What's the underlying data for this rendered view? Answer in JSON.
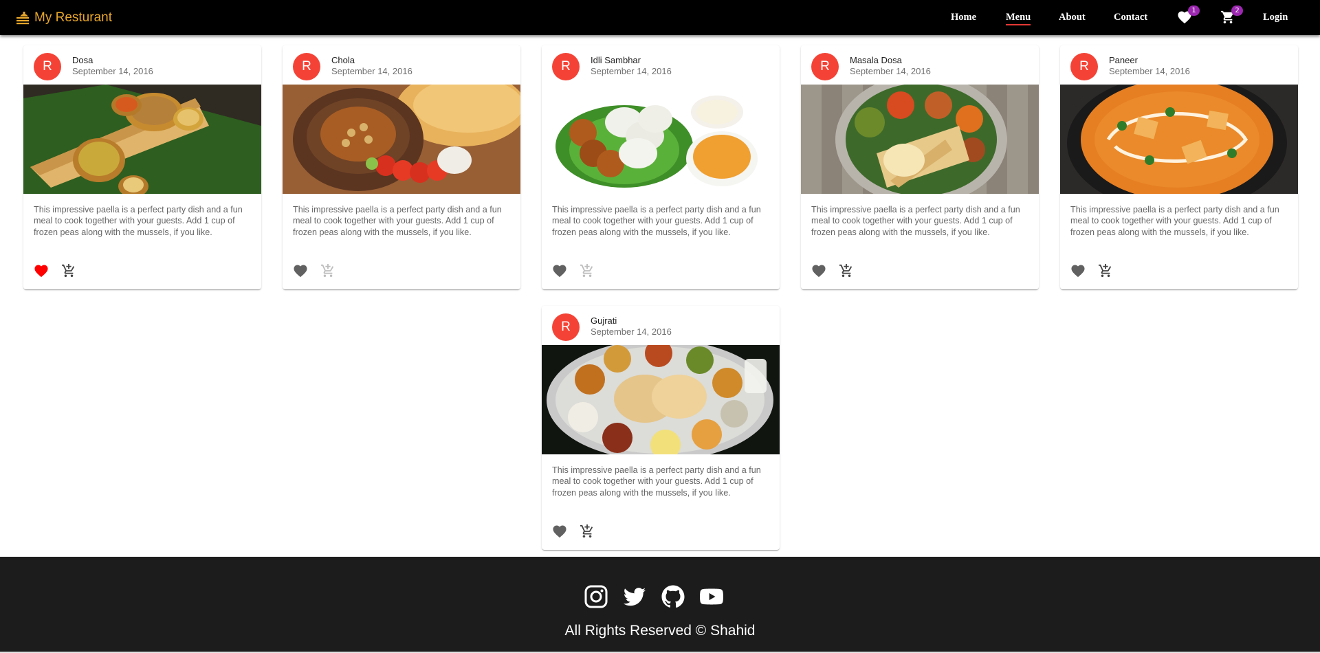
{
  "brand": {
    "name": "My Resturant",
    "icon": "food-cart-icon",
    "color": "#e9a72b"
  },
  "nav": {
    "home": "Home",
    "menu": "Menu",
    "about": "About",
    "contact": "Contact",
    "login": "Login",
    "favorites_icon": "heart-icon",
    "favorites_count": "1",
    "cart_icon": "cart-icon",
    "cart_count": "2",
    "active": "Menu"
  },
  "cards": [
    {
      "avatar": "R",
      "title": "Dosa",
      "date": "September 14, 2016",
      "text": "This impressive paella is a perfect party dish and a fun meal to cook together with your guests. Add 1 cup of frozen peas along with the mussels, if you like.",
      "liked": true,
      "image": "dosa-photo"
    },
    {
      "avatar": "R",
      "title": "Chola",
      "date": "September 14, 2016",
      "text": "This impressive paella is a perfect party dish and a fun meal to cook together with your guests. Add 1 cup of frozen peas along with the mussels, if you like.",
      "liked": false,
      "image": "chola-photo"
    },
    {
      "avatar": "R",
      "title": "Idli Sambhar",
      "date": "September 14, 2016",
      "text": "This impressive paella is a perfect party dish and a fun meal to cook together with your guests. Add 1 cup of frozen peas along with the mussels, if you like.",
      "liked": false,
      "image": "idli-sambhar-photo"
    },
    {
      "avatar": "R",
      "title": "Masala Dosa",
      "date": "September 14, 2016",
      "text": "This impressive paella is a perfect party dish and a fun meal to cook together with your guests. Add 1 cup of frozen peas along with the mussels, if you like.",
      "liked": false,
      "image": "masala-dosa-photo"
    },
    {
      "avatar": "R",
      "title": "Paneer",
      "date": "September 14, 2016",
      "text": "This impressive paella is a perfect party dish and a fun meal to cook together with your guests. Add 1 cup of frozen peas along with the mussels, if you like.",
      "liked": false,
      "image": "paneer-photo"
    },
    {
      "avatar": "R",
      "title": "Gujrati",
      "date": "September 14, 2016",
      "text": "This impressive paella is a perfect party dish and a fun meal to cook together with your guests. Add 1 cup of frozen peas along with the mussels, if you like.",
      "liked": false,
      "image": "gujrati-thali-photo"
    }
  ],
  "colors": {
    "avatar": "#f44336",
    "liked_heart": "#ff0000",
    "badge": "#9c27b0",
    "footer_bg": "#1c1c1c",
    "active_underline": "#e53935"
  },
  "footer": {
    "social": [
      "instagram-icon",
      "twitter-icon",
      "github-icon",
      "youtube-icon"
    ],
    "copyright": "All Rights Reserved © Shahid"
  }
}
